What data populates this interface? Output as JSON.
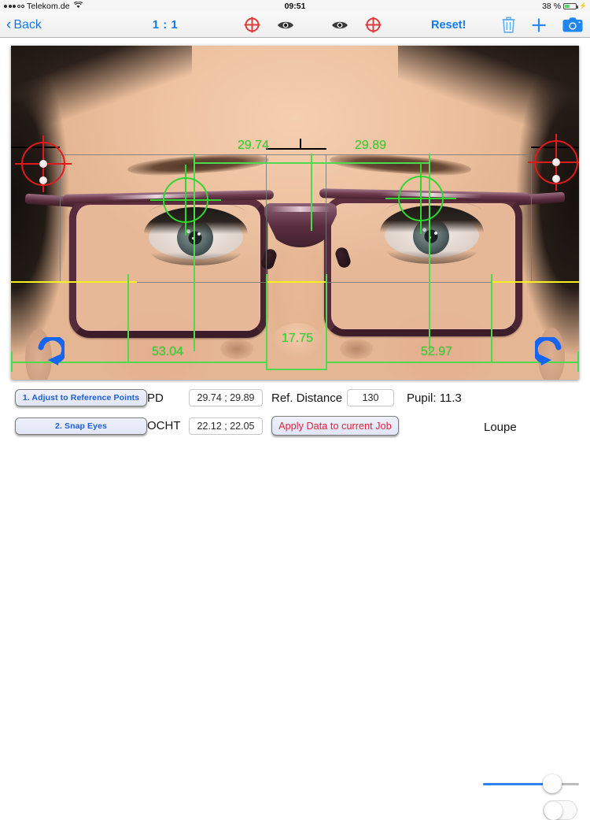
{
  "statusbar": {
    "carrier": "Telekom.de",
    "time": "09:51",
    "battery_pct": "38 %",
    "wifi_icon": "wifi-icon",
    "battery_icon": "battery-icon",
    "charging_icon": "lightning-bolt-icon"
  },
  "navbar": {
    "back_label": "Back",
    "ratio_label": "1 : 1",
    "reset_label": "Reset!",
    "icons": {
      "target_left": "crosshair-target-icon",
      "eye_left": "eye-icon",
      "eye_right": "eye-icon",
      "target_right": "crosshair-target-icon",
      "trash": "trash-icon",
      "add": "plus-icon",
      "camera": "camera-icon"
    }
  },
  "photo": {
    "alt": "front-facing portrait of woman wearing eyeglasses",
    "rotate_left_icon": "rotate-clockwise-icon",
    "rotate_right_icon": "rotate-counterclockwise-icon",
    "measurements": {
      "pd_left": "29.74",
      "pd_right": "29.89",
      "frame_left": "53.04",
      "frame_right": "52.97",
      "bridge": "17.75"
    },
    "markers": {
      "pupil_left": "green-pupil-crosshair",
      "pupil_right": "green-pupil-crosshair",
      "reference_left": "red-reference-crosshair",
      "reference_right": "red-reference-crosshair"
    },
    "colors": {
      "measure_green": "#2fd62f",
      "reference_red": "#e01b1b",
      "baseline_yellow": "#f5f01e",
      "grid_gray": "#787878"
    }
  },
  "panel": {
    "btn_adjust": "1. Adjust to Reference Points",
    "btn_snap": "2. Snap Eyes",
    "label_pd": "PD",
    "value_pd": "29.74 ; 29.89",
    "label_ocht": "OCHT",
    "value_ocht": "22.12 ; 22.05",
    "label_ref_distance": "Ref. Distance",
    "value_ref_distance": "130",
    "btn_apply": "Apply Data to current Job",
    "label_pupil": "Pupil: 11.3",
    "label_loupe": "Loupe",
    "zoom_slider_value": "70",
    "loupe_toggle_state": "off",
    "accent_blue": "#1479ed",
    "apply_red": "#e0213a"
  }
}
